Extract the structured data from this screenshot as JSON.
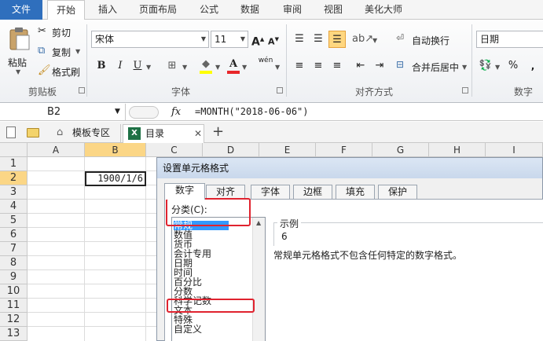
{
  "menu_tabs": [
    "文件",
    "开始",
    "插入",
    "页面布局",
    "公式",
    "数据",
    "审阅",
    "视图",
    "美化大师"
  ],
  "active_menu_tab": "开始",
  "ribbon": {
    "clipboard": {
      "paste": "粘贴",
      "cut": "剪切",
      "copy": "复制",
      "format_painter": "格式刷",
      "group": "剪贴板"
    },
    "font": {
      "name": "宋体",
      "size": "11",
      "bold": "B",
      "italic": "I",
      "underline": "U",
      "grow": "A",
      "shrink": "A",
      "wen": "wén",
      "group": "字体"
    },
    "alignment": {
      "wrap_text": "自动换行",
      "merge_center": "合并后居中",
      "group": "对齐方式"
    },
    "number": {
      "format": "日期",
      "percent": "%",
      "group": "数字"
    }
  },
  "formula_bar": {
    "cell_ref": "B2",
    "fx": "fx",
    "formula": "=MONTH(\"2018-06-06\")"
  },
  "doc_tabs": {
    "template": "模板专区",
    "workbook": "目录",
    "add": "+"
  },
  "grid": {
    "columns": [
      "A",
      "B",
      "C",
      "D",
      "E",
      "F",
      "G",
      "H",
      "I"
    ],
    "rows": [
      "1",
      "2",
      "3",
      "4",
      "5",
      "6",
      "7",
      "8",
      "9",
      "10",
      "11",
      "12",
      "13"
    ],
    "active_col": "B",
    "active_row": "2",
    "b2_value": "1900/1/6"
  },
  "dialog": {
    "title": "设置单元格格式",
    "tabs": [
      "数字",
      "对齐",
      "字体",
      "边框",
      "填充",
      "保护"
    ],
    "active_tab": "数字",
    "category_label": "分类(C):",
    "categories": [
      "常规",
      "数值",
      "货币",
      "会计专用",
      "日期",
      "时间",
      "百分比",
      "分数",
      "科学记数",
      "文本",
      "特殊",
      "自定义"
    ],
    "selected_category": "常规",
    "sample_label": "示例",
    "sample_value": "6",
    "description": "常规单元格格式不包含任何特定的数字格式。"
  },
  "colors": {
    "accent_blue": "#2f6fbd",
    "highlight_red": "#e0232f",
    "selection": "#3399ff",
    "active_header": "#fbd686"
  }
}
